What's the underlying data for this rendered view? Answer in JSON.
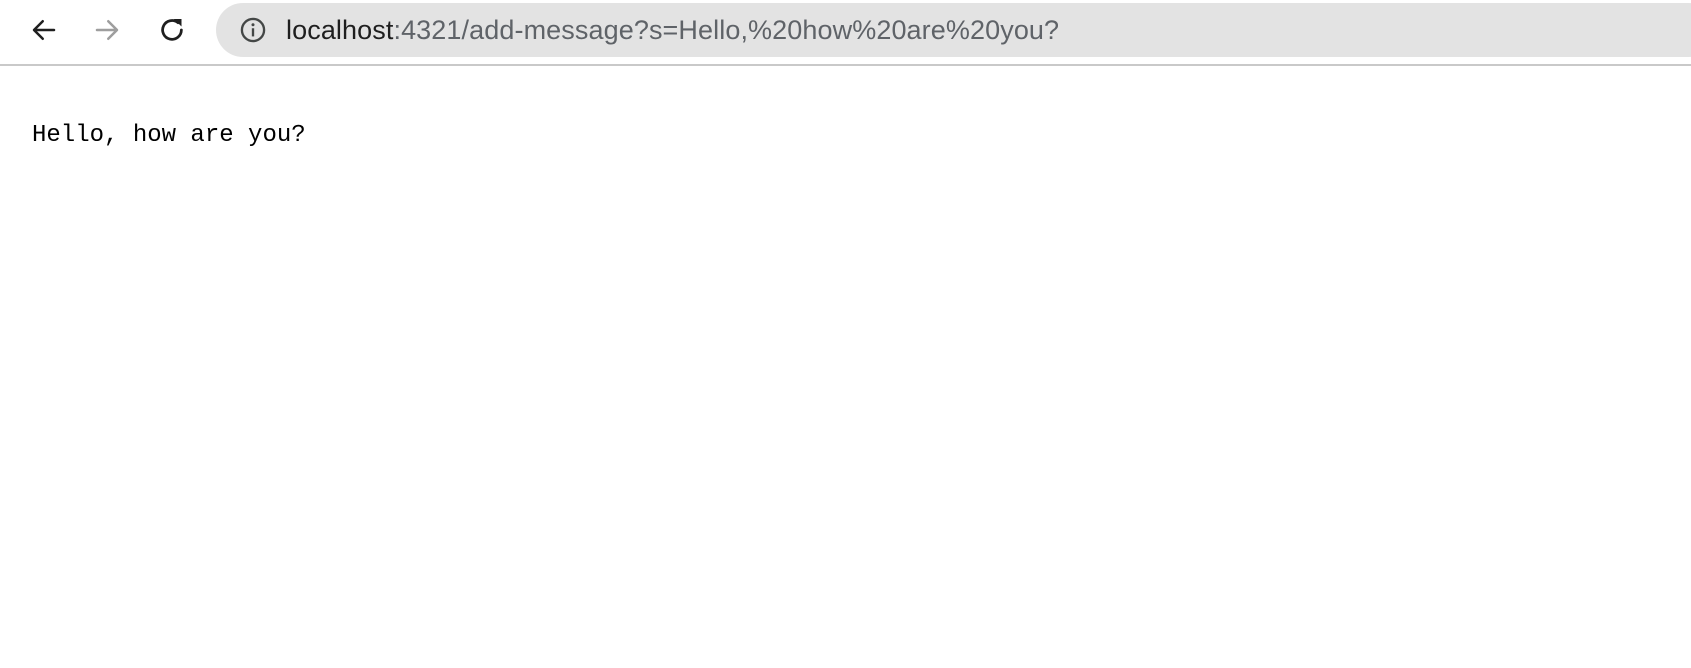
{
  "browser": {
    "address_bar": {
      "host": "localhost",
      "path": ":4321/add-message?s=Hello,%20how%20are%20you?"
    },
    "icons": {
      "back": "arrow-left-icon",
      "forward": "arrow-right-icon",
      "reload": "reload-icon",
      "site_info": "info-circle-icon"
    },
    "colors": {
      "omnibox_bg": "#e3e3e3",
      "host_text": "#1f1f1f",
      "path_text": "#5f6368",
      "forward_disabled": "#9e9e9e"
    }
  },
  "page": {
    "message": "Hello, how are you?"
  }
}
